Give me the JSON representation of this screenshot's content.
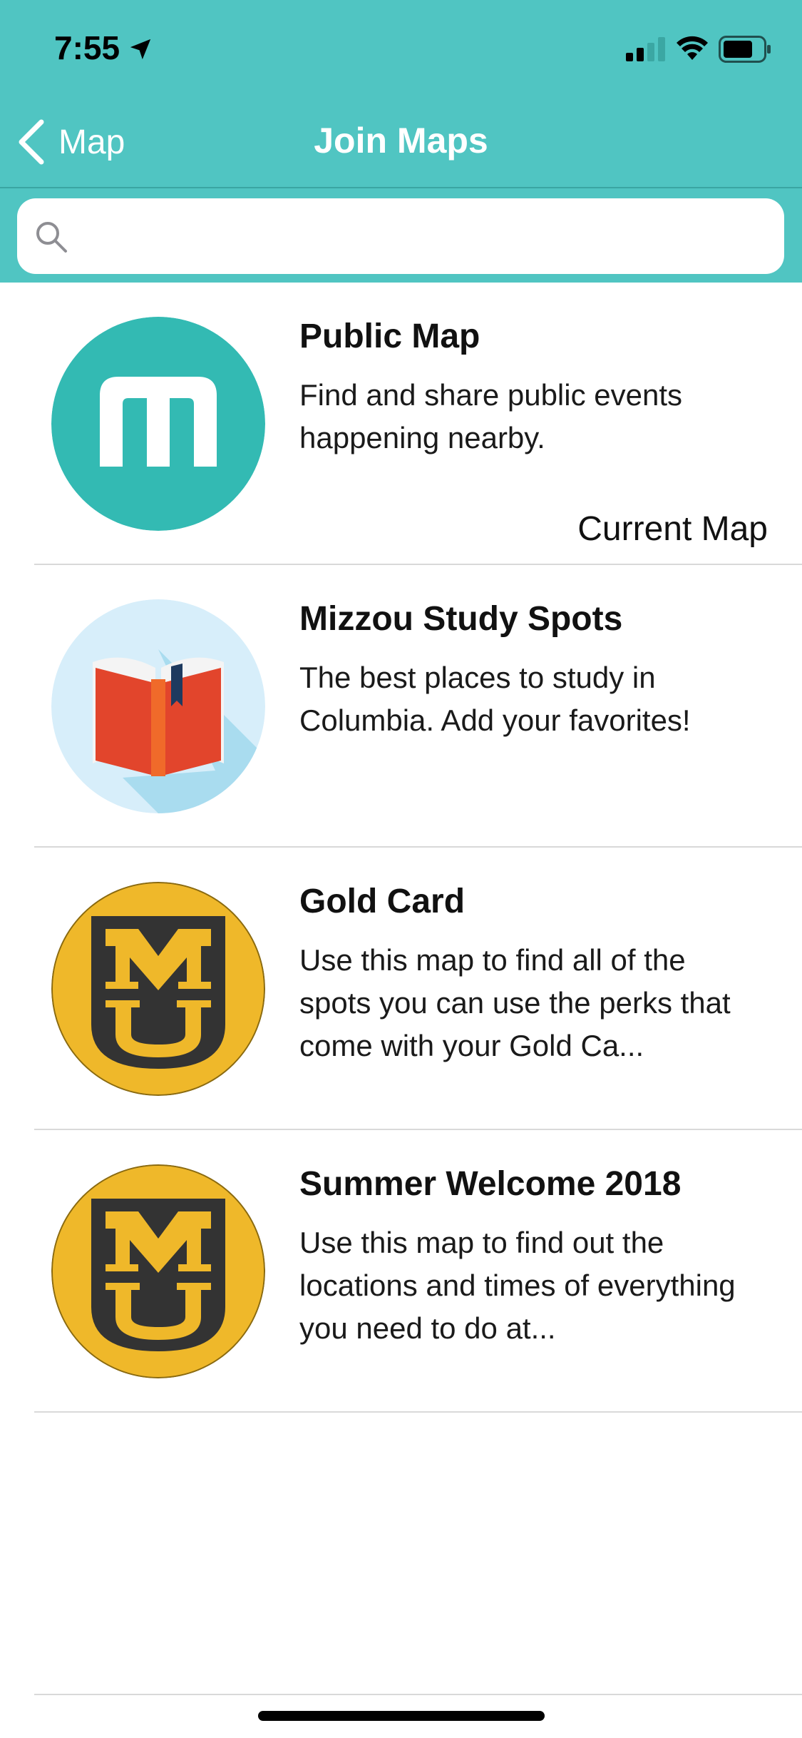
{
  "status_bar": {
    "time": "7:55",
    "icons": [
      "location-arrow-icon",
      "cellular-signal-icon",
      "wifi-icon",
      "battery-icon"
    ]
  },
  "nav": {
    "back_label": "Map",
    "title": "Join Maps"
  },
  "search": {
    "placeholder": "",
    "value": ""
  },
  "maps": [
    {
      "title": "Public Map",
      "description": "Find and share public events happening nearby.",
      "badge": "Current Map",
      "icon": "public-map-m-icon"
    },
    {
      "title": "Mizzou Study Spots",
      "description": "The best places to study in Columbia. Add your favorites!",
      "icon": "open-book-icon"
    },
    {
      "title": "Gold Card",
      "description": "Use this map to find all of the spots you can use the perks that come with your Gold Ca...",
      "icon": "mizzou-mu-logo-icon"
    },
    {
      "title": "Summer Welcome 2018",
      "description": "Use this map to find out the locations and times of everything you need to do at...",
      "icon": "mizzou-mu-logo-icon"
    }
  ],
  "colors": {
    "header": "#50c5c2",
    "public_map_circle": "#33bab3",
    "book_circle": "#d7eefa",
    "gold": "#efb82a",
    "shield": "#333333"
  }
}
